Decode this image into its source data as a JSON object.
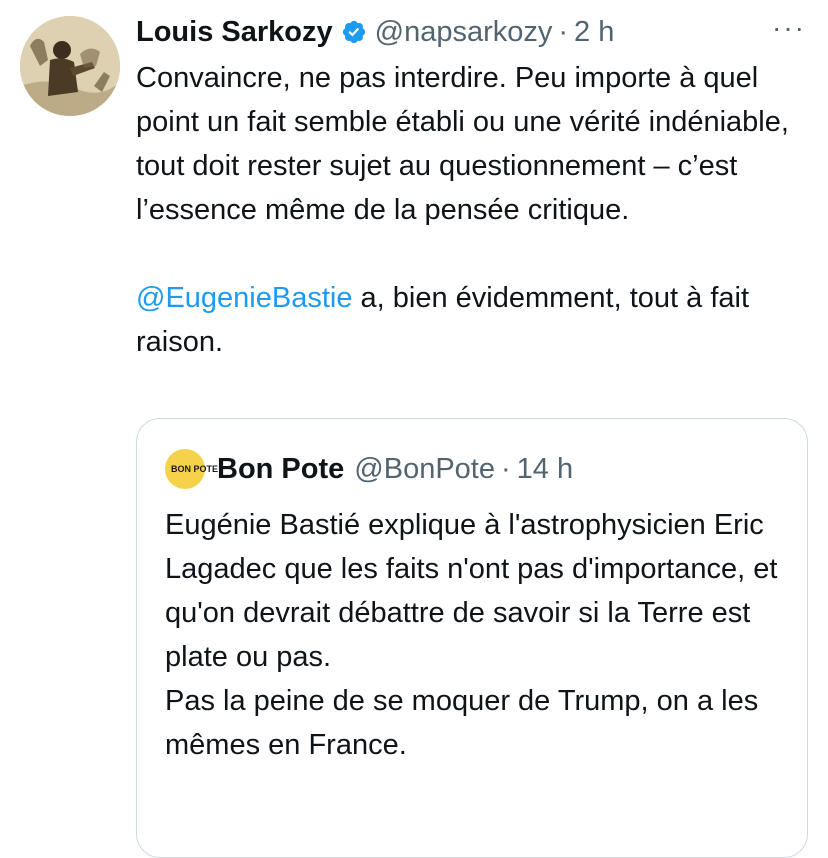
{
  "tweet": {
    "author_name": "Louis Sarkozy",
    "handle": "@napsarkozy",
    "separator": "·",
    "time": "2 h",
    "more_icon": "more-options-icon",
    "verified_icon": "verified-badge-icon",
    "paragraph1": "Convaincre, ne pas interdire. Peu importe à quel point un fait semble établi ou une vérité indéniable, tout doit rester sujet au questionnement – c’est l’essence même de la pensée critique.",
    "mention": "@EugenieBastie",
    "paragraph2_rest": " a, bien évidemment, tout à fait raison."
  },
  "quoted_tweet": {
    "avatar_text": "BON POTE",
    "author_name": "Bon Pote",
    "handle": "@BonPote",
    "separator": "·",
    "time": "14 h",
    "line1": "Eugénie Bastié explique à l'astrophysicien Eric Lagadec que les faits n'ont pas d'importance, et qu'on devrait débattre de savoir si la Terre est plate ou pas.",
    "line2": "Pas la peine de se moquer de Trump, on a les mêmes en France."
  },
  "colors": {
    "text": "#0f1419",
    "secondary": "#536471",
    "link": "#1d9bf0",
    "border": "#cfd9de",
    "bonpote_yellow": "#f5d24a"
  }
}
